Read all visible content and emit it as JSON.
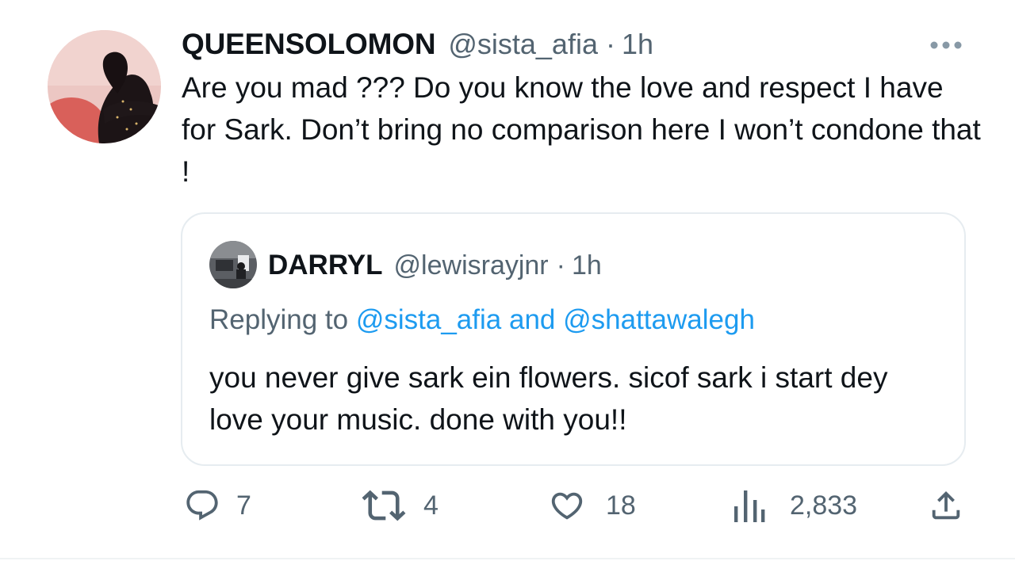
{
  "tweet": {
    "display_name": "QUEENSOLOMON",
    "handle": "@sista_afia",
    "separator": "·",
    "time": "1h",
    "text": "Are you mad ???  Do you know the love and respect I have for Sark. Don’t bring no comparison here I won’t condone that !",
    "more_icon": "more-horizontal-icon"
  },
  "quoted_tweet": {
    "display_name": "DARRYL",
    "handle": "@lewisrayjnr",
    "separator": "·",
    "time": "1h",
    "replying_prefix": "Replying to",
    "reply_mention_1": "@sista_afia",
    "reply_and": "and",
    "reply_mention_2": "@shattawalegh",
    "text": "you never give sark ein flowers. sicof sark i start dey love your music. done with you!!"
  },
  "actions": {
    "reply": {
      "icon": "reply-icon",
      "count": "7"
    },
    "retweet": {
      "icon": "retweet-icon",
      "count": "4"
    },
    "like": {
      "icon": "heart-icon",
      "count": "18"
    },
    "views": {
      "icon": "views-icon",
      "count": "2,833"
    },
    "share": {
      "icon": "share-icon"
    }
  },
  "colors": {
    "text": "#0f1419",
    "secondary": "#536471",
    "link": "#1d9bf0",
    "border": "#e6ecf0"
  }
}
